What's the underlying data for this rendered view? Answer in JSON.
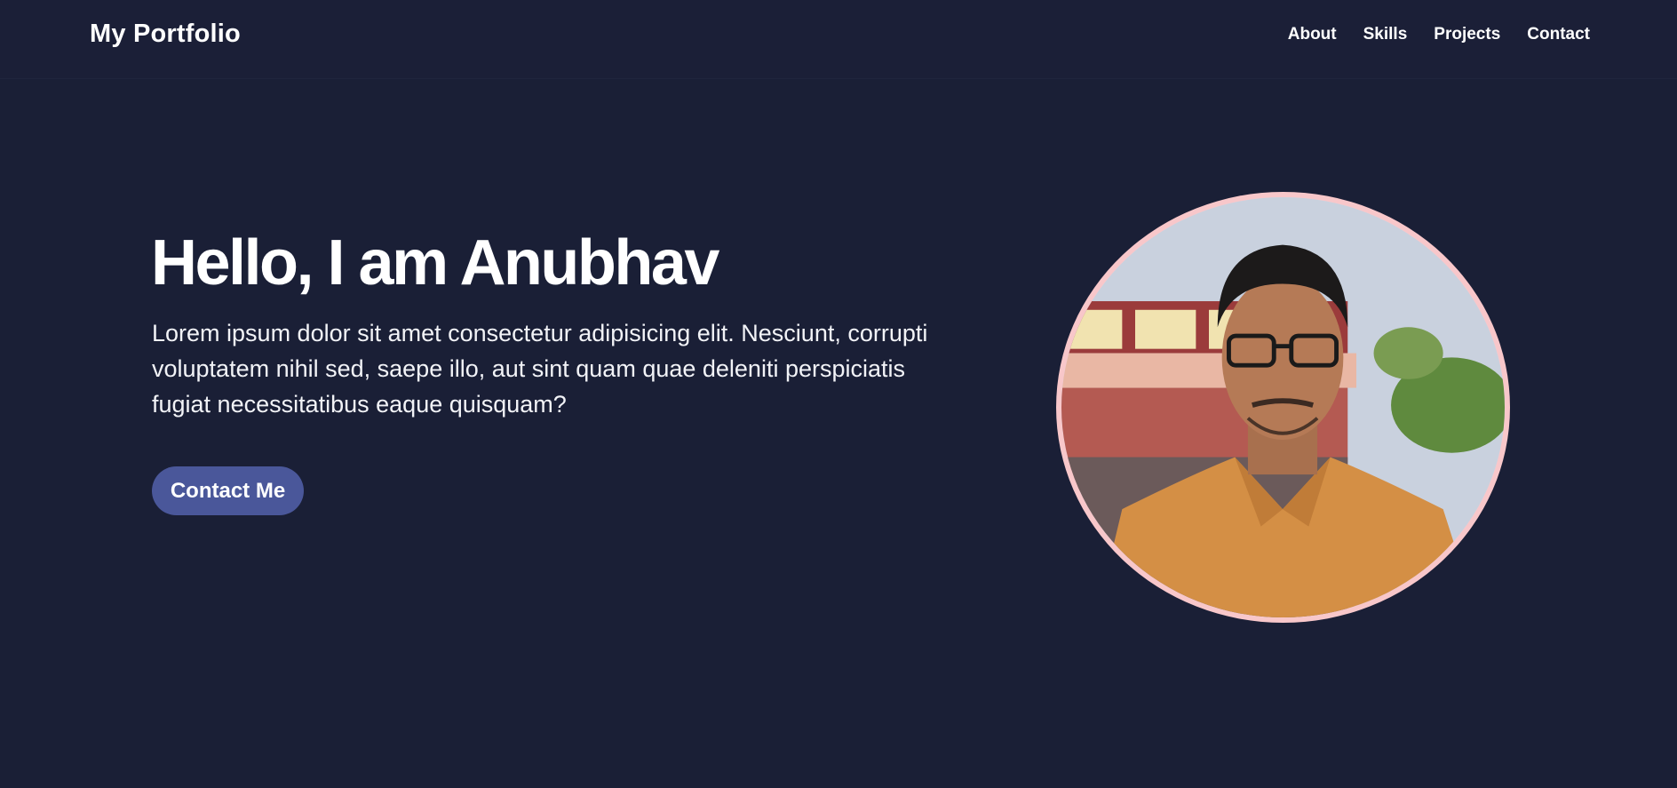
{
  "header": {
    "brand": "My Portfolio",
    "nav": [
      {
        "label": "About"
      },
      {
        "label": "Skills"
      },
      {
        "label": "Projects"
      },
      {
        "label": "Contact"
      }
    ]
  },
  "hero": {
    "title": "Hello, I am Anubhav",
    "description": "Lorem ipsum dolor sit amet consectetur adipisicing elit. Nesciunt, corrupti voluptatem nihil sed, saepe illo, aut sint quam quae deleniti perspiciatis fugiat necessitatibus eaque quisquam?",
    "cta_label": "Contact Me"
  },
  "colors": {
    "background": "#1a1f36",
    "accent": "#4a579a",
    "portrait_border": "#f8c7ca"
  }
}
